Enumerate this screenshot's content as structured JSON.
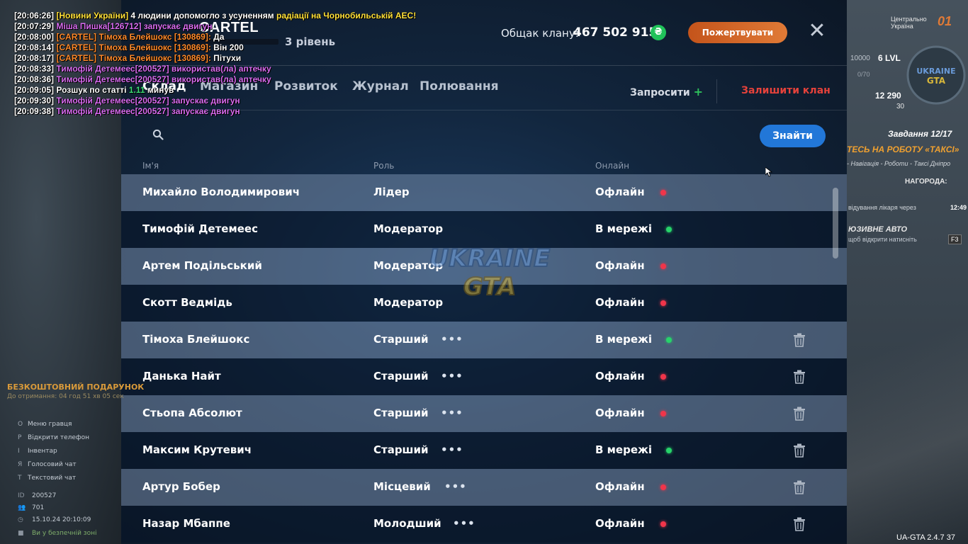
{
  "header": {
    "clan_name": "CARTEL",
    "level": "3 рівень",
    "treasury_label": "Общак клану:",
    "treasury_value": "467 502 915",
    "currency_symbol": "₴",
    "donate_label": "Пожертвувати",
    "close_symbol": "✕"
  },
  "tabs": [
    {
      "label": "Склад",
      "active": true
    },
    {
      "label": "Магазин",
      "active": false
    },
    {
      "label": "Розвиток",
      "active": false
    },
    {
      "label": "Журнал",
      "active": false
    },
    {
      "label": "Полювання",
      "active": false
    }
  ],
  "actions": {
    "invite_label": "Запросити",
    "invite_plus": "+",
    "leave_label": "Залишити клан"
  },
  "search": {
    "placeholder": "",
    "button_label": "Знайти"
  },
  "columns": {
    "name": "Ім'я",
    "role": "Роль",
    "online": "Онлайн"
  },
  "members": [
    {
      "name": "Михайло Володимирович",
      "role": "Лідер",
      "status": "Офлайн",
      "online": false,
      "menu": false,
      "delete": false
    },
    {
      "name": "Тимофій Детемеес",
      "role": "Модератор",
      "status": "В мережі",
      "online": true,
      "menu": false,
      "delete": false
    },
    {
      "name": "Артем Подільський",
      "role": "Модератор",
      "status": "Офлайн",
      "online": false,
      "menu": false,
      "delete": false
    },
    {
      "name": "Скотт Ведмідь",
      "role": "Модератор",
      "status": "Офлайн",
      "online": false,
      "menu": false,
      "delete": false
    },
    {
      "name": "Тімоха Блейшокс",
      "role": "Старший",
      "status": "В мережі",
      "online": true,
      "menu": true,
      "delete": true
    },
    {
      "name": "Данька Найт",
      "role": "Старший",
      "status": "Офлайн",
      "online": false,
      "menu": true,
      "delete": true
    },
    {
      "name": "Стьопа Абсолют",
      "role": "Старший",
      "status": "Офлайн",
      "online": false,
      "menu": true,
      "delete": true
    },
    {
      "name": "Максим Крутевич",
      "role": "Старший",
      "status": "В мережі",
      "online": true,
      "menu": true,
      "delete": true
    },
    {
      "name": "Артур Бобер",
      "role": "Місцевий",
      "status": "Офлайн",
      "online": false,
      "menu": true,
      "delete": true
    },
    {
      "name": "Назар Мбаппе",
      "role": "Молодший",
      "status": "Офлайн",
      "online": false,
      "menu": true,
      "delete": true
    }
  ],
  "menu_dots": "•••",
  "chat": [
    {
      "time": "[20:06:26]",
      "parts": [
        {
          "t": "[Новини України]",
          "c": "c-yellow"
        },
        {
          "t": " 4 людини допомогло з усуненням ",
          "c": "c-white"
        },
        {
          "t": "радіації на Чорнобильській АЕС!",
          "c": "c-yellow"
        }
      ]
    },
    {
      "time": "[20:07:29]",
      "parts": [
        {
          "t": "Міша Пишка[126712] запускає двигун",
          "c": "c-purple"
        }
      ]
    },
    {
      "time": "[20:08:00]",
      "parts": [
        {
          "t": "[CARTEL] Тімоха Блейшокс [130869]: ",
          "c": "c-orange"
        },
        {
          "t": "Да",
          "c": "c-white"
        }
      ]
    },
    {
      "time": "[20:08:14]",
      "parts": [
        {
          "t": "[CARTEL] Тімоха Блейшокс [130869]: ",
          "c": "c-orange"
        },
        {
          "t": "Він 200",
          "c": "c-white"
        }
      ]
    },
    {
      "time": "[20:08:17]",
      "parts": [
        {
          "t": "[CARTEL] Тімоха Блейшокс [130869]: ",
          "c": "c-orange"
        },
        {
          "t": "Пітухи",
          "c": "c-white"
        }
      ]
    },
    {
      "time": "[20:08:33]",
      "parts": [
        {
          "t": "Тимофій Детемеес[200527] використав(ла) аптечку",
          "c": "c-purple"
        }
      ]
    },
    {
      "time": "[20:08:36]",
      "parts": [
        {
          "t": "Тимофій Детемеес[200527] використав(ла) аптечку",
          "c": "c-purple"
        }
      ]
    },
    {
      "time": "[20:09:05]",
      "parts": [
        {
          "t": "Розшук по статті ",
          "c": "c-white"
        },
        {
          "t": "1.11",
          "c": "c-green"
        },
        {
          "t": " минув",
          "c": "c-white"
        }
      ]
    },
    {
      "time": "[20:09:30]",
      "parts": [
        {
          "t": "Тимофій Детемеес[200527] запускає двигун",
          "c": "c-purple"
        }
      ]
    },
    {
      "time": "[20:09:38]",
      "parts": [
        {
          "t": "Тимофій Детемеес[200527] запускає двигун",
          "c": "c-purple"
        }
      ]
    }
  ],
  "hud_left": {
    "gift_title": "БЕЗКОШТОВНИЙ ПОДАРУНОК",
    "gift_sub": "До отримання: 04 год 51 хв 05 сек",
    "hotkeys": [
      {
        "key": "O",
        "label": "Меню гравця"
      },
      {
        "key": "P",
        "label": "Відкрити телефон"
      },
      {
        "key": "I",
        "label": "Інвентар"
      },
      {
        "key": "Я",
        "label": "Голосовий чат"
      },
      {
        "key": "T",
        "label": "Текстовий чат"
      }
    ],
    "id_label": "ID",
    "id_value": "200527",
    "online_label": "",
    "online_value": "701",
    "datetime": "15.10.24 20:10:09",
    "zone": "Ви у безпечній зоні"
  },
  "hud_right": {
    "region": "Центрально Україна",
    "region_num": "01",
    "money": "10000",
    "lvl": "6 LVL",
    "exp": "0/70",
    "cash": "12 290",
    "coins": "30",
    "task_title": "Завдання 12/17",
    "task_name": "ТЕСЬ НА РОБОТУ «ТАКСІ»",
    "task_path": "- Навігація - Роботи - Таксі Дніпро",
    "reward": "НАГОРОДА:",
    "doctor": "відування лікаря через",
    "doctor_time": "12:49",
    "auto_title": "ЮЗИВНЕ АВТО",
    "auto_sub": "щоб відкрити натисніть",
    "auto_key": "F3"
  },
  "watermark": "UKRAINE GTA",
  "version": "UA-GTA 2.4.7   37",
  "colors": {
    "accent": "#2277d8",
    "donate": "#d9682a",
    "online": "#27d36a",
    "offline": "#f0354a",
    "leave": "#e5423b"
  }
}
